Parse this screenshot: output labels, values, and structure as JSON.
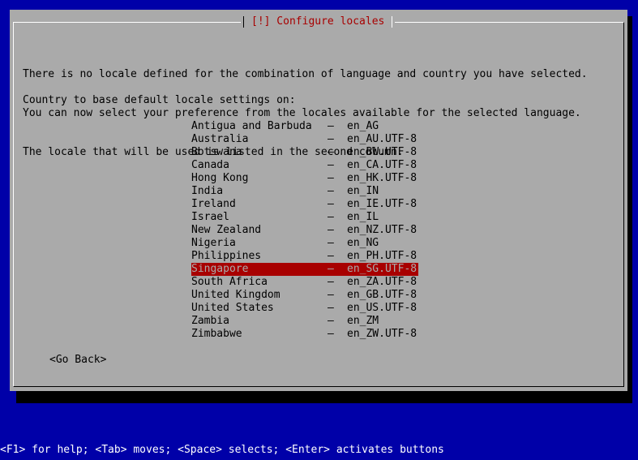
{
  "dialog": {
    "title": "[!] Configure locales",
    "message_lines": [
      "There is no locale defined for the combination of language and country you have selected.",
      "You can now select your preference from the locales available for the selected language.",
      "The locale that will be used is listed in the second column."
    ],
    "prompt": "Country to base default locale settings on:",
    "separator": "–",
    "options": [
      {
        "country": "Antigua and Barbuda",
        "locale": "en_AG"
      },
      {
        "country": "Australia",
        "locale": "en_AU.UTF-8"
      },
      {
        "country": "Botswana",
        "locale": "en_BW.UTF-8"
      },
      {
        "country": "Canada",
        "locale": "en_CA.UTF-8"
      },
      {
        "country": "Hong Kong",
        "locale": "en_HK.UTF-8"
      },
      {
        "country": "India",
        "locale": "en_IN"
      },
      {
        "country": "Ireland",
        "locale": "en_IE.UTF-8"
      },
      {
        "country": "Israel",
        "locale": "en_IL"
      },
      {
        "country": "New Zealand",
        "locale": "en_NZ.UTF-8"
      },
      {
        "country": "Nigeria",
        "locale": "en_NG"
      },
      {
        "country": "Philippines",
        "locale": "en_PH.UTF-8"
      },
      {
        "country": "Singapore",
        "locale": "en_SG.UTF-8"
      },
      {
        "country": "South Africa",
        "locale": "en_ZA.UTF-8"
      },
      {
        "country": "United Kingdom",
        "locale": "en_GB.UTF-8"
      },
      {
        "country": "United States",
        "locale": "en_US.UTF-8"
      },
      {
        "country": "Zambia",
        "locale": "en_ZM"
      },
      {
        "country": "Zimbabwe",
        "locale": "en_ZW.UTF-8"
      }
    ],
    "selected_index": 11,
    "go_back_label": "<Go Back>"
  },
  "status_bar": {
    "text": "<F1> for help; <Tab> moves; <Space> selects; <Enter> activates buttons"
  },
  "colors": {
    "background": "#0000a8",
    "dialog": "#aaaaaa",
    "title": "#a80000",
    "selection": "#a80000"
  }
}
